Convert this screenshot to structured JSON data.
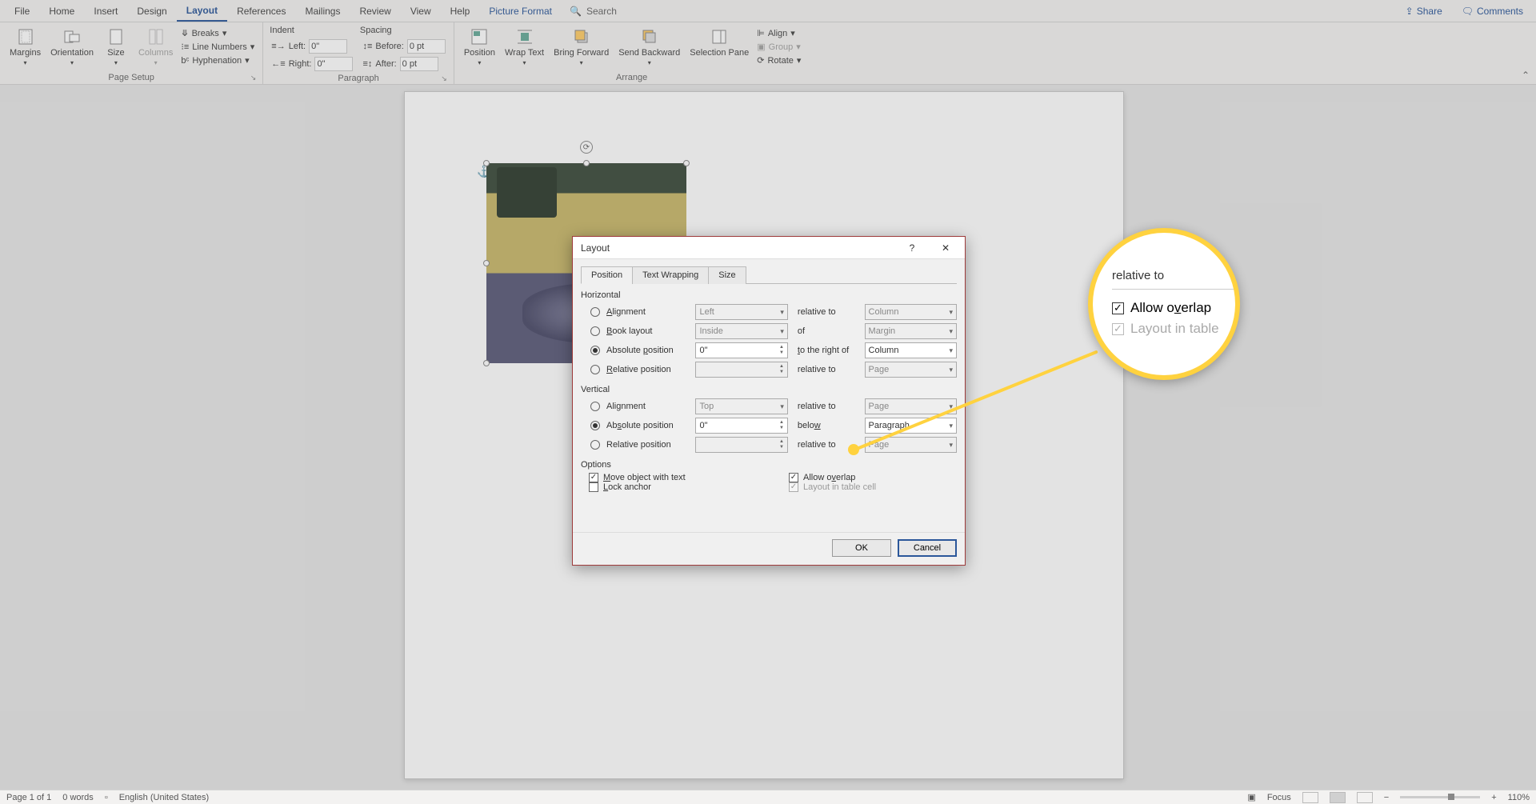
{
  "tabs": {
    "items": [
      "File",
      "Home",
      "Insert",
      "Design",
      "Layout",
      "References",
      "Mailings",
      "Review",
      "View",
      "Help",
      "Picture Format"
    ],
    "active_index": 4,
    "search_placeholder": "Search",
    "share": "Share",
    "comments": "Comments"
  },
  "ribbon": {
    "page_setup": {
      "label": "Page Setup",
      "margins": "Margins",
      "orientation": "Orientation",
      "size": "Size",
      "columns": "Columns",
      "breaks": "Breaks",
      "line_numbers": "Line Numbers",
      "hyphenation": "Hyphenation"
    },
    "paragraph": {
      "label": "Paragraph",
      "indent": "Indent",
      "spacing": "Spacing",
      "left_lbl": "Left:",
      "right_lbl": "Right:",
      "before_lbl": "Before:",
      "after_lbl": "After:",
      "left_val": "0\"",
      "right_val": "0\"",
      "before_val": "0 pt",
      "after_val": "0 pt"
    },
    "arrange": {
      "label": "Arrange",
      "position": "Position",
      "wrap": "Wrap Text",
      "forward": "Bring Forward",
      "backward": "Send Backward",
      "selpane": "Selection Pane",
      "align": "Align",
      "group": "Group",
      "rotate": "Rotate"
    }
  },
  "dialog": {
    "title": "Layout",
    "tabs": [
      "Position",
      "Text Wrapping",
      "Size"
    ],
    "active_tab": 0,
    "horizontal": {
      "title": "Horizontal",
      "alignment": "Alignment",
      "book": "Book layout",
      "abs": "Absolute position",
      "rel": "Relative position",
      "align_val": "Left",
      "align_rel_lbl": "relative to",
      "align_rel_val": "Column",
      "book_val": "Inside",
      "book_rel_lbl": "of",
      "book_rel_val": "Margin",
      "abs_val": "0\"",
      "abs_rel_lbl": "to the right of",
      "abs_rel_val": "Column",
      "rel_val": "",
      "rel_rel_lbl": "relative to",
      "rel_rel_val": "Page",
      "selected": 2
    },
    "vertical": {
      "title": "Vertical",
      "alignment": "Alignment",
      "abs": "Absolute position",
      "rel": "Relative position",
      "align_val": "Top",
      "align_rel_lbl": "relative to",
      "align_rel_val": "Page",
      "abs_val": "0\"",
      "abs_rel_lbl": "below",
      "abs_rel_val": "Paragraph",
      "rel_val": "",
      "rel_rel_lbl": "relative to",
      "rel_rel_val": "Page",
      "selected": 1
    },
    "options": {
      "title": "Options",
      "move": "Move object with text",
      "lock": "Lock anchor",
      "overlap": "Allow overlap",
      "table": "Layout in table cell",
      "move_checked": true,
      "lock_checked": false,
      "overlap_checked": true,
      "table_checked": true,
      "table_disabled": true
    },
    "ok": "OK",
    "cancel": "Cancel",
    "help": "?",
    "close": "✕"
  },
  "magnifier": {
    "top": "relative to",
    "overlap": "Allow overlap",
    "table": "Layout in table"
  },
  "status": {
    "page": "Page 1 of 1",
    "words": "0 words",
    "lang": "English (United States)",
    "focus": "Focus",
    "zoom": "110%"
  }
}
